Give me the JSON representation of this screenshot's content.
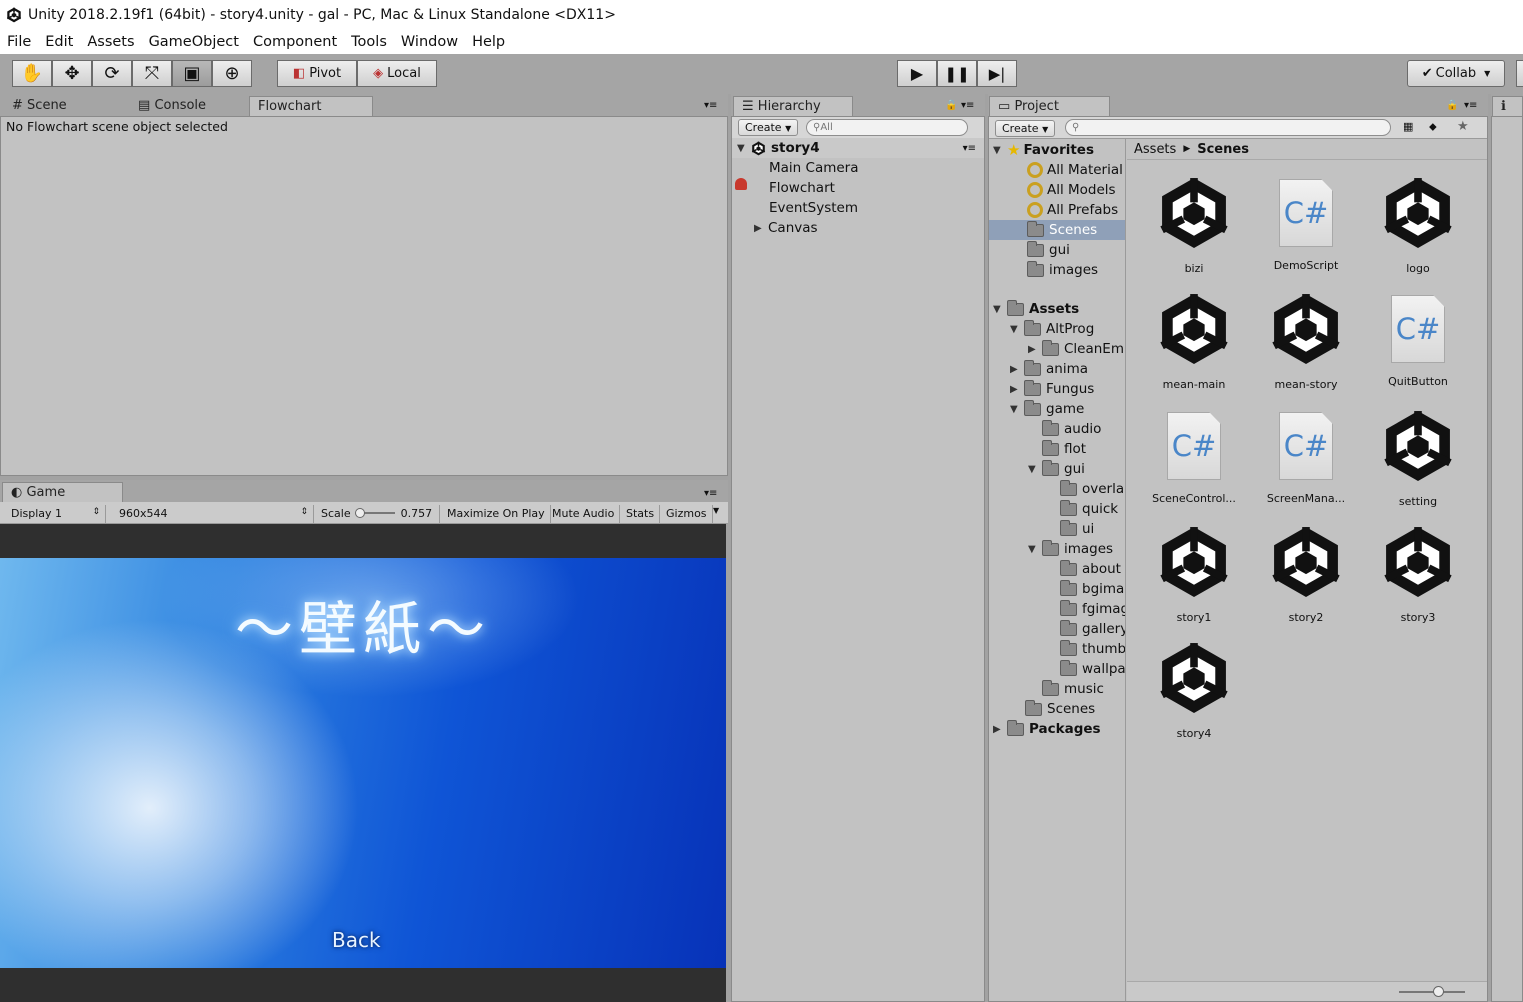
{
  "window": {
    "title": "Unity 2018.2.19f1 (64bit) - story4.unity - gal - PC, Mac & Linux Standalone <DX11>"
  },
  "menu": [
    "File",
    "Edit",
    "Assets",
    "GameObject",
    "Component",
    "Tools",
    "Window",
    "Help"
  ],
  "toolbar": {
    "pivot": "Pivot",
    "local": "Local",
    "collab": "Collab"
  },
  "scene_tabs": {
    "scene": "Scene",
    "console": "Console",
    "flowchart": "Flowchart"
  },
  "flowchart": {
    "message": "No Flowchart scene object selected"
  },
  "game": {
    "tab": "Game",
    "display": "Display 1",
    "resolution": "960x544",
    "scale_label": "Scale",
    "scale_value": "0.757",
    "maximize": "Maximize On Play",
    "mute": "Mute Audio",
    "stats": "Stats",
    "gizmos": "Gizmos",
    "title_text": "～壁紙～",
    "back": "Back"
  },
  "hierarchy": {
    "tab": "Hierarchy",
    "create": "Create",
    "search_placeholder": "All",
    "scene": "story4",
    "items": [
      "Main Camera",
      "Flowchart",
      "EventSystem",
      "Canvas"
    ]
  },
  "project": {
    "tab": "Project",
    "create": "Create",
    "breadcrumb": [
      "Assets",
      "Scenes"
    ],
    "favorites_label": "Favorites",
    "favorites": [
      "All Material",
      "All Models",
      "All Prefabs",
      "Scenes",
      "gui",
      "images"
    ],
    "tree": [
      "Assets",
      "AltProg",
      "CleanEm",
      "anima",
      "Fungus",
      "game",
      "audio",
      "flot",
      "gui",
      "overla",
      "quick",
      "ui",
      "images",
      "about",
      "bgima",
      "fgimag",
      "gallery",
      "thumb",
      "wallpa",
      "music",
      "Scenes",
      "Packages"
    ],
    "assets": [
      {
        "name": "bizi",
        "kind": "unity"
      },
      {
        "name": "DemoScript",
        "kind": "cs"
      },
      {
        "name": "logo",
        "kind": "unity"
      },
      {
        "name": "mean-main",
        "kind": "unity"
      },
      {
        "name": "mean-story",
        "kind": "unity"
      },
      {
        "name": "QuitButton",
        "kind": "cs"
      },
      {
        "name": "SceneControl...",
        "kind": "cs"
      },
      {
        "name": "ScreenMana...",
        "kind": "cs"
      },
      {
        "name": "setting",
        "kind": "unity"
      },
      {
        "name": "story1",
        "kind": "unity"
      },
      {
        "name": "story2",
        "kind": "unity"
      },
      {
        "name": "story3",
        "kind": "unity"
      },
      {
        "name": "story4",
        "kind": "unity"
      }
    ],
    "cs_glyph": "C#"
  },
  "colors": {
    "panel": "#c2c2c2",
    "toolbar": "#a5a5a5",
    "selected": "#8fa0b8",
    "game_sky": "#1560d8"
  }
}
